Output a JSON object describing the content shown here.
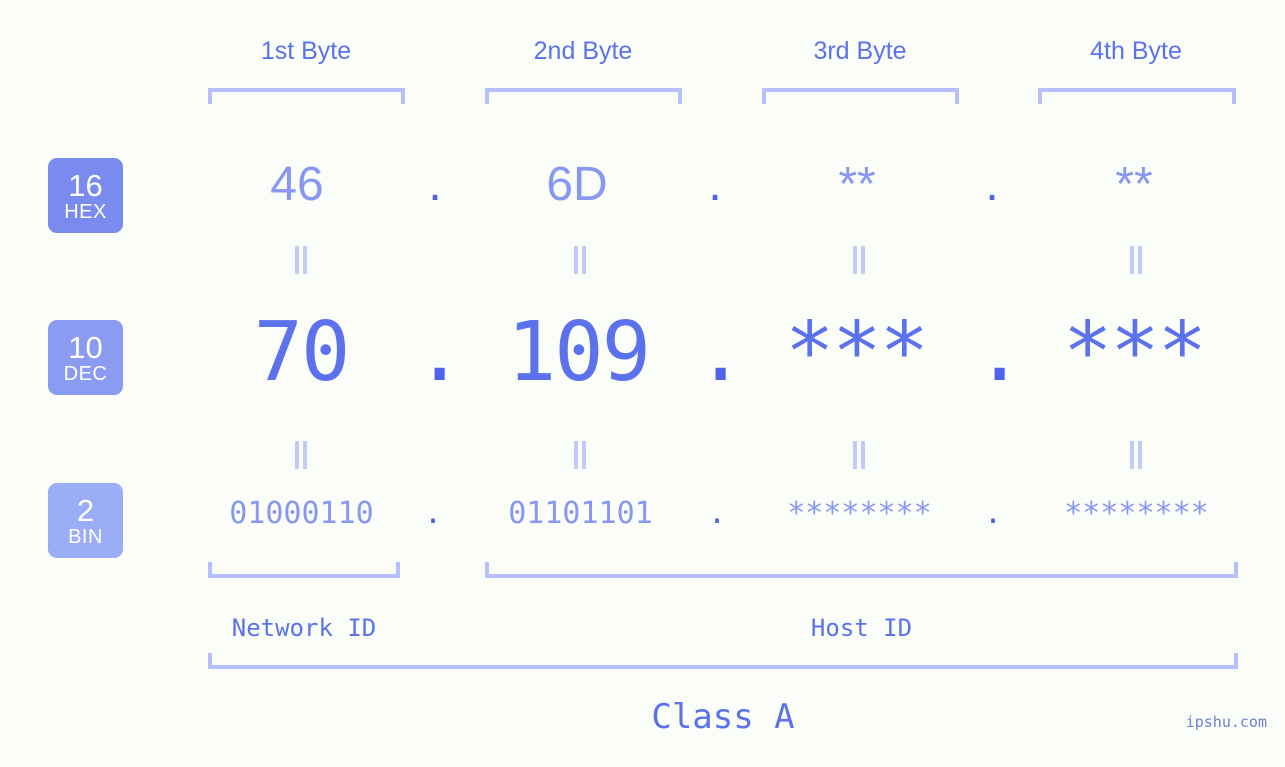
{
  "meta": {
    "background_color": "#fbfdf8",
    "accent_color": "#5c72ec",
    "muted_accent_color": "#8797f2",
    "bracket_color": "#b7c0fb",
    "dot_color": "#4e63e8",
    "watermark": "ipshu.com"
  },
  "header": {
    "bytes": [
      {
        "label": "1st Byte"
      },
      {
        "label": "2nd Byte"
      },
      {
        "label": "3rd Byte"
      },
      {
        "label": "4th Byte"
      }
    ]
  },
  "bases": [
    {
      "number": "16",
      "abbr": "HEX",
      "color": "#7a8bef"
    },
    {
      "number": "10",
      "abbr": "DEC",
      "color": "#8c9bf2"
    },
    {
      "number": "2",
      "abbr": "BIN",
      "color": "#9badf6"
    }
  ],
  "rows": {
    "hex": {
      "base_number": "16",
      "base_abbr": "HEX",
      "octets": [
        "46",
        "6D",
        "**",
        "**"
      ],
      "separator": "."
    },
    "dec": {
      "base_number": "10",
      "base_abbr": "DEC",
      "octets": [
        "70",
        "109",
        "***",
        "***"
      ],
      "separator": "."
    },
    "bin": {
      "base_number": "2",
      "base_abbr": "BIN",
      "octets": [
        "01000110",
        "01101101",
        "********",
        "********"
      ],
      "separator": "."
    }
  },
  "equality_marker": "=",
  "footer": {
    "network_id_label": "Network ID",
    "host_id_label": "Host ID",
    "class_label": "Class A"
  }
}
